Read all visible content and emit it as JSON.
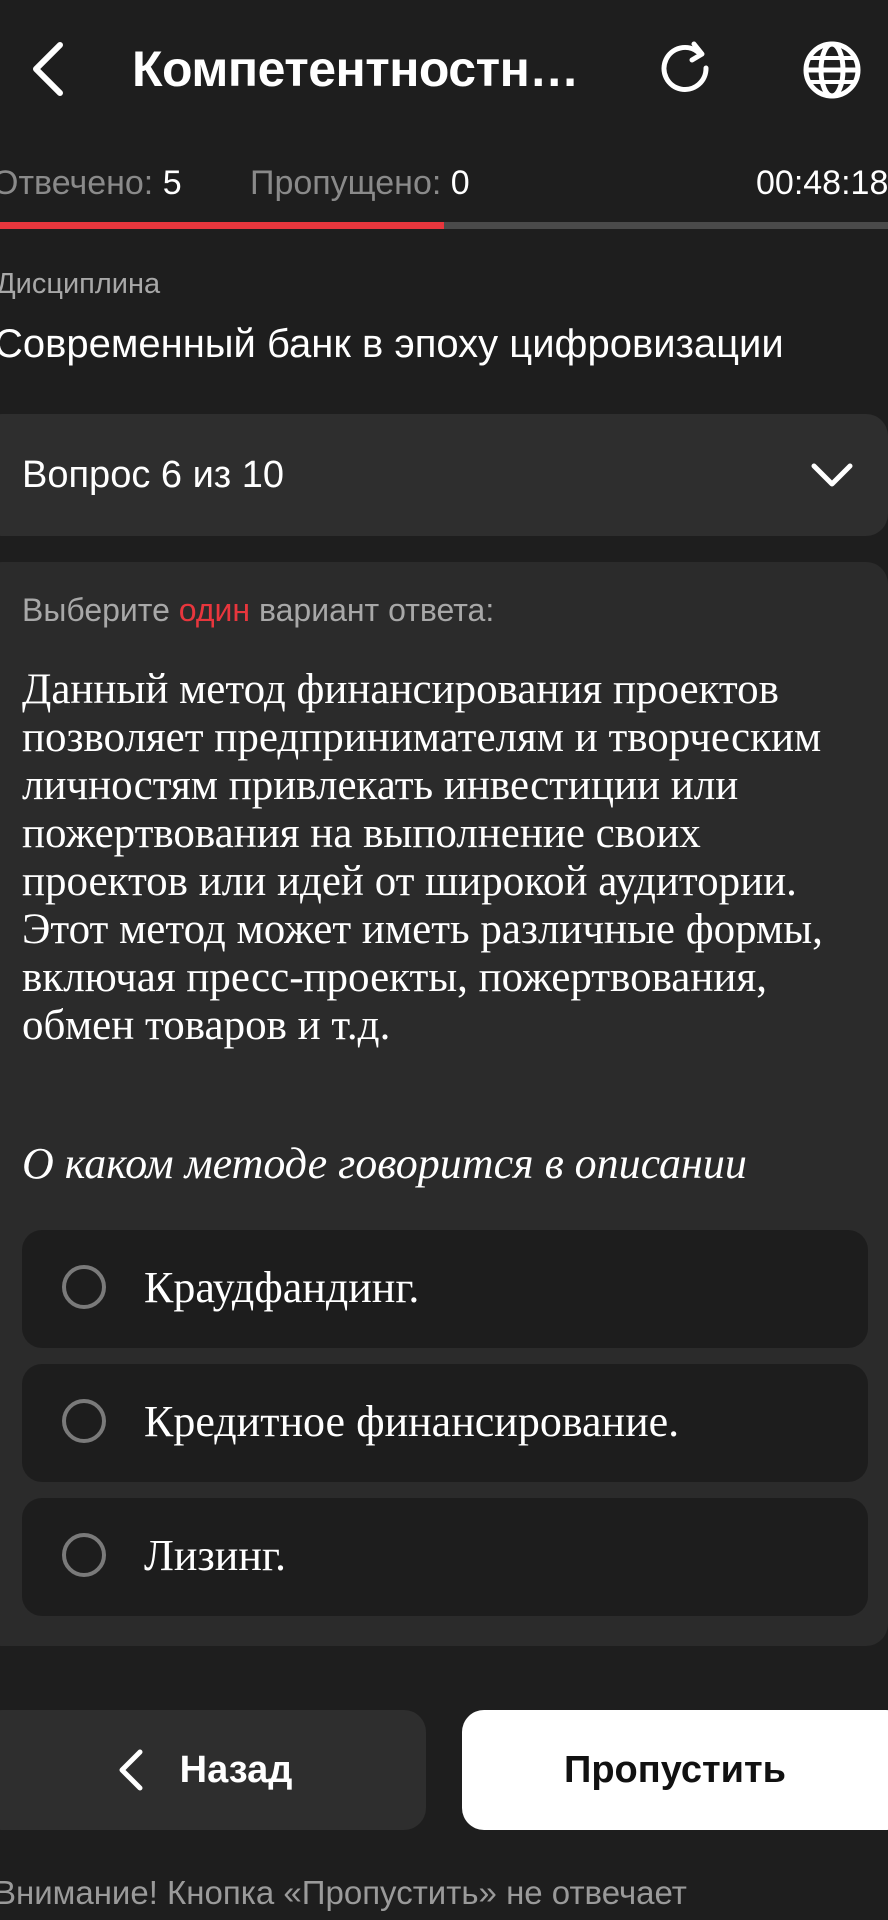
{
  "header": {
    "title": "Компетентностны...",
    "icons": {
      "back": "chevron-left-icon",
      "refresh": "refresh-icon",
      "language": "globe-icon"
    }
  },
  "stats": {
    "answered_label": "Отвечено:",
    "answered_value": "5",
    "skipped_label": "Пропущено:",
    "skipped_value": "0",
    "timer": "00:48:18",
    "progress": 0.5
  },
  "discipline": {
    "label": "Дисциплина",
    "value": "Современный банк в эпоху цифровизации"
  },
  "question_selector": {
    "label": "Вопрос 6 из 10",
    "icon": "chevron-down-icon"
  },
  "question": {
    "instruction_prefix": "Выберите ",
    "instruction_accent": "один",
    "instruction_suffix": " вариант ответа:",
    "text": "Данный метод финансирования проектов позволяет предпринимателям и творческим личностям привлекать инвестиции или пожертвования на выполнение своих проектов или идей от широкой аудитории. Этот метод может иметь различные формы, включая пресс-проекты, пожертвования, обмен товаров и т.д.",
    "prompt": "О каком методе говорится в описании",
    "options": [
      {
        "label": "Краудфандинг."
      },
      {
        "label": "Кредитное финансирование."
      },
      {
        "label": "Лизинг."
      }
    ]
  },
  "buttons": {
    "back_label": "Назад",
    "skip_label": "Пропустить"
  },
  "footer": {
    "warning": "Внимание! Кнопка «Пропустить» не отвечает"
  },
  "colors": {
    "background": "#1e1e1e",
    "accent": "#e8363d",
    "card": "#2b2b2b",
    "option": "#1d1d1d"
  }
}
